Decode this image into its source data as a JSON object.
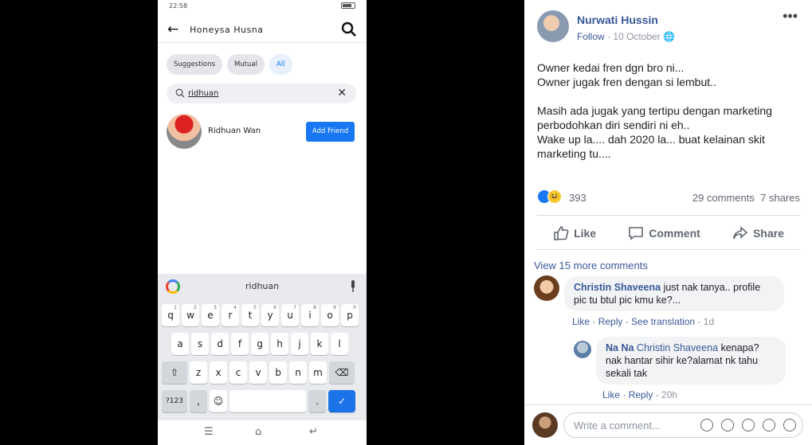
{
  "phone": {
    "status_time": "22:58",
    "header_title": "Honeysa Husna",
    "chips": [
      "Suggestions",
      "Mutual",
      "All"
    ],
    "search_value": "ridhuan",
    "result": {
      "name": "Ridhuan Wan",
      "button": "Add Friend"
    },
    "keyboard": {
      "suggestion": "ridhuan",
      "row1": [
        "q",
        "w",
        "e",
        "r",
        "t",
        "y",
        "u",
        "i",
        "o",
        "p"
      ],
      "row1_hints": [
        "1",
        "2",
        "3",
        "4",
        "5",
        "6",
        "7",
        "8",
        "9",
        "0"
      ],
      "row2": [
        "a",
        "s",
        "d",
        "f",
        "g",
        "h",
        "j",
        "k",
        "l"
      ],
      "row3": [
        "z",
        "x",
        "c",
        "v",
        "b",
        "n",
        "m"
      ],
      "sym_label": "?123",
      "comma": ",",
      "period": "."
    }
  },
  "post": {
    "author": "Nurwati Hussin",
    "follow": "Follow",
    "sep": " · ",
    "date": "10 October",
    "body": [
      "Owner kedai fren dgn bro ni...",
      "Owner jugak fren dengan si lembut..",
      "",
      "Masih ada jugak yang tertipu dengan marketing",
      "perbodohkan diri sendiri ni eh..",
      "Wake up la.... dah 2020 la... buat kelainan skit",
      "marketing tu...."
    ],
    "reaction_count": "393",
    "comments_count": "29 comments",
    "shares_count": "7 shares",
    "actions": {
      "like": "Like",
      "comment": "Comment",
      "share": "Share"
    },
    "view_more": "View 15 more comments",
    "comment1": {
      "author": "Christin Shaveena",
      "text": "just nak tanya.. profile pic tu btul pic kmu ke?...",
      "like": "Like",
      "reply": "Reply",
      "translate": "See translation",
      "time": "1d"
    },
    "comment2": {
      "author": "Na Na",
      "mention": "Christin Shaveena",
      "text": "kenapa? nak hantar sihir ke?alamat nk tahu sekali tak",
      "like": "Like",
      "reply": "Reply",
      "time": "20h"
    },
    "write_placeholder": "Write a comment..."
  },
  "colors": {
    "fb_blue": "#1877f2",
    "link": "#385898",
    "meta": "#90949c"
  }
}
